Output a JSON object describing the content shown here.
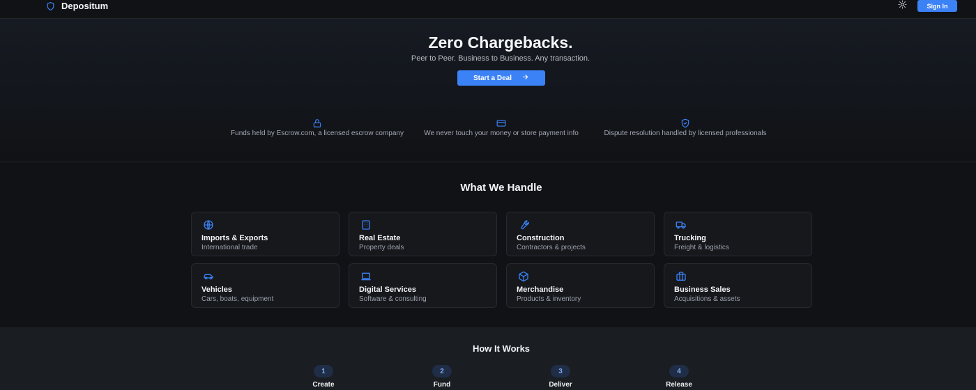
{
  "header": {
    "brand": "Depositum",
    "sign_in": "Sign In"
  },
  "hero": {
    "title": "Zero Chargebacks.",
    "subtitle": "Peer to Peer. Business to Business. Any transaction.",
    "cta": "Start a Deal"
  },
  "features": [
    {
      "icon": "lock-icon",
      "text": "Funds held by Escrow.com, a licensed escrow company"
    },
    {
      "icon": "credit-card-icon",
      "text": "We never touch your money or store payment info"
    },
    {
      "icon": "shield-check-icon",
      "text": "Dispute resolution handled by licensed professionals"
    }
  ],
  "handle": {
    "title": "What We Handle",
    "cards": [
      {
        "icon": "globe-icon",
        "title": "Imports & Exports",
        "subtitle": "International trade"
      },
      {
        "icon": "building-icon",
        "title": "Real Estate",
        "subtitle": "Property deals"
      },
      {
        "icon": "wrench-icon",
        "title": "Construction",
        "subtitle": "Contractors & projects"
      },
      {
        "icon": "truck-icon",
        "title": "Trucking",
        "subtitle": "Freight & logistics"
      },
      {
        "icon": "car-icon",
        "title": "Vehicles",
        "subtitle": "Cars, boats, equipment"
      },
      {
        "icon": "laptop-icon",
        "title": "Digital Services",
        "subtitle": "Software & consulting"
      },
      {
        "icon": "package-icon",
        "title": "Merchandise",
        "subtitle": "Products & inventory"
      },
      {
        "icon": "briefcase-icon",
        "title": "Business Sales",
        "subtitle": "Acquisitions & assets"
      }
    ]
  },
  "how": {
    "title": "How It Works",
    "steps": [
      {
        "number": "1",
        "label": "Create"
      },
      {
        "number": "2",
        "label": "Fund"
      },
      {
        "number": "3",
        "label": "Deliver"
      },
      {
        "number": "4",
        "label": "Release"
      }
    ]
  },
  "colors": {
    "accent": "#3b82f6",
    "background": "#111215",
    "card": "#16181c"
  }
}
